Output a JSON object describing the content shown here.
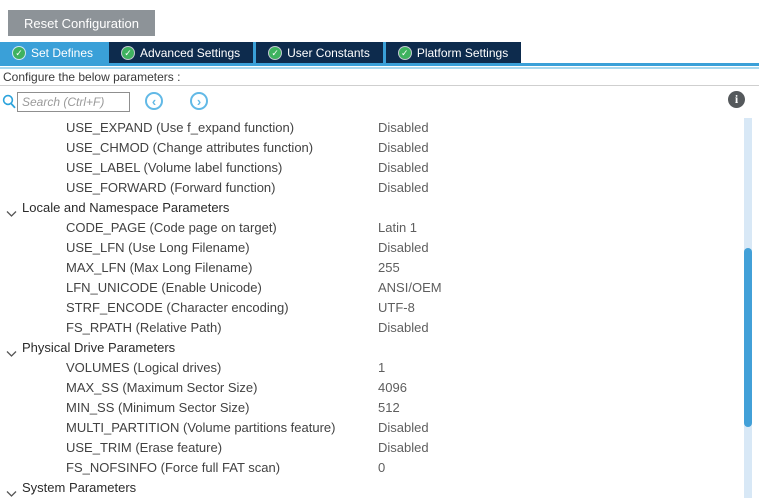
{
  "toolbar": {
    "reset_label": "Reset Configuration"
  },
  "tabs": [
    {
      "label": "Set Defines",
      "active": true
    },
    {
      "label": "Advanced Settings",
      "active": false
    },
    {
      "label": "User Constants",
      "active": false
    },
    {
      "label": "Platform Settings",
      "active": false
    }
  ],
  "subtitle": "Configure the below parameters :",
  "search": {
    "placeholder": "Search (Ctrl+F)"
  },
  "icons": {
    "check": "✓",
    "prev": "‹",
    "next": "›",
    "info": "i"
  },
  "colors": {
    "accent_blue": "#3aa0d8",
    "tab_navy": "#0d2b4d",
    "tab_green_check": "#3eb25f",
    "reset_button_gray": "#8d9398",
    "scroll_track": "#d8e8f6",
    "scroll_thumb": "#42a0d8"
  },
  "parameters": [
    {
      "type": "param",
      "name": "USE_EXPAND (Use f_expand function)",
      "value": "Disabled"
    },
    {
      "type": "param",
      "name": "USE_CHMOD (Change attributes function)",
      "value": "Disabled"
    },
    {
      "type": "param",
      "name": "USE_LABEL (Volume label functions)",
      "value": "Disabled"
    },
    {
      "type": "param",
      "name": "USE_FORWARD (Forward function)",
      "value": "Disabled"
    },
    {
      "type": "section",
      "label": "Locale and Namespace Parameters"
    },
    {
      "type": "param",
      "name": "CODE_PAGE (Code page on target)",
      "value": "Latin 1"
    },
    {
      "type": "param",
      "name": "USE_LFN (Use Long Filename)",
      "value": "Disabled"
    },
    {
      "type": "param",
      "name": "MAX_LFN (Max Long Filename)",
      "value": "255"
    },
    {
      "type": "param",
      "name": "LFN_UNICODE (Enable Unicode)",
      "value": "ANSI/OEM"
    },
    {
      "type": "param",
      "name": "STRF_ENCODE (Character encoding)",
      "value": "UTF-8"
    },
    {
      "type": "param",
      "name": "FS_RPATH (Relative Path)",
      "value": "Disabled"
    },
    {
      "type": "section",
      "label": "Physical Drive Parameters"
    },
    {
      "type": "param",
      "name": "VOLUMES (Logical drives)",
      "value": "1"
    },
    {
      "type": "param",
      "name": "MAX_SS (Maximum Sector Size)",
      "value": "4096"
    },
    {
      "type": "param",
      "name": "MIN_SS (Minimum Sector Size)",
      "value": "512"
    },
    {
      "type": "param",
      "name": "MULTI_PARTITION (Volume partitions feature)",
      "value": "Disabled"
    },
    {
      "type": "param",
      "name": "USE_TRIM (Erase feature)",
      "value": "Disabled"
    },
    {
      "type": "param",
      "name": "FS_NOFSINFO (Force full FAT scan)",
      "value": "0"
    },
    {
      "type": "section",
      "label": "System Parameters"
    }
  ]
}
